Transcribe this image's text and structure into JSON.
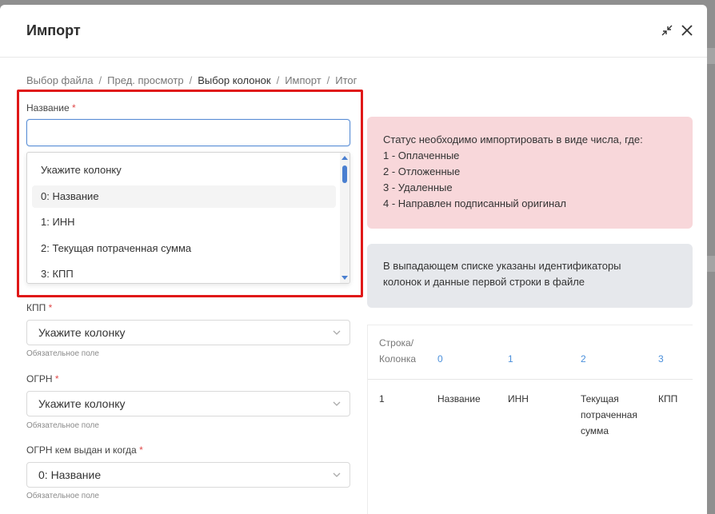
{
  "window": {
    "title": "Импорт"
  },
  "breadcrumbs": [
    {
      "label": "Выбор файла",
      "active": false
    },
    {
      "label": "Пред. просмотр",
      "active": false
    },
    {
      "label": "Выбор колонок",
      "active": true
    },
    {
      "label": "Импорт",
      "active": false
    },
    {
      "label": "Итог",
      "active": false
    }
  ],
  "fields": {
    "name": {
      "label": "Название",
      "required_mark": "*",
      "value": ""
    },
    "kpp": {
      "label": "КПП",
      "required_mark": "*",
      "value": "Укажите колонку",
      "hint": "Обязательное поле"
    },
    "ogrn": {
      "label": "ОГРН",
      "required_mark": "*",
      "value": "Укажите колонку",
      "hint": "Обязательное поле"
    },
    "ogrn_issued": {
      "label": "ОГРН кем выдан и когда",
      "required_mark": "*",
      "value": "0: Название",
      "hint": "Обязательное поле"
    }
  },
  "dropdown": {
    "options": [
      "Укажите колонку",
      "0: Название",
      "1: ИНН",
      "2: Текущая потраченная сумма",
      "3: КПП"
    ],
    "highlighted_index": 1
  },
  "info": {
    "status_lines": [
      "Статус необходимо импортировать в виде числа, где:",
      "1 - Оплаченные",
      "2 - Отложенные",
      "3 - Удаленные",
      "4 - Направлен подписанный оригинал"
    ],
    "dropdown_note_lines": [
      "В выпадающем списке указаны идентификаторы",
      "колонок и данные первой строки в файле"
    ]
  },
  "preview_table": {
    "corner_header_lines": [
      "Строка/",
      "Колонка"
    ],
    "column_ids": [
      "0",
      "1",
      "2",
      "3"
    ],
    "rows": [
      {
        "row_id": "1",
        "cells": [
          [
            "Название"
          ],
          [
            "ИНН"
          ],
          [
            "Текущая",
            "потраченная",
            "сумма"
          ],
          [
            "КПП"
          ]
        ]
      }
    ]
  },
  "colors": {
    "accent": "#4a8fdb",
    "required": "#e04a4a",
    "highlight_frame": "#e01818",
    "status_box": "#f8d7da",
    "note_box": "#e6e8ec"
  }
}
